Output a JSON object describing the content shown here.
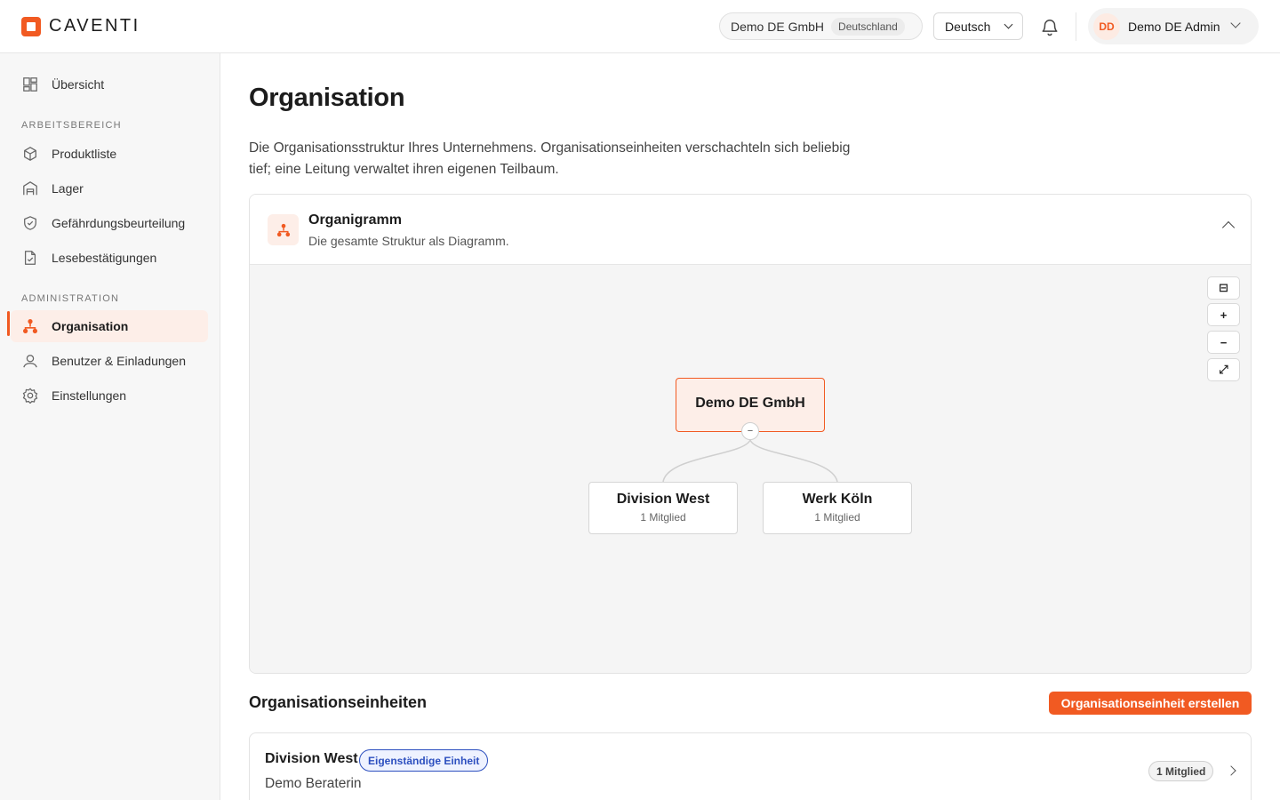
{
  "brand": {
    "name": "CAVENTI"
  },
  "topbar": {
    "org_name": "Demo DE GmbH",
    "org_country": "Deutschland",
    "language": "Deutsch",
    "user_initials": "DD",
    "user_name": "Demo DE Admin"
  },
  "sidebar": {
    "overview": "Übersicht",
    "section_workspace": "ARBEITSBEREICH",
    "workspace_items": [
      "Produktliste",
      "Lager",
      "Gefährdungsbeurteilung",
      "Lesebestätigungen"
    ],
    "section_admin": "ADMINISTRATION",
    "admin_items": [
      "Organisation",
      "Benutzer & Einladungen",
      "Einstellungen"
    ],
    "active_item": "Organisation"
  },
  "main": {
    "title": "Organisation",
    "description": "Die Organisationsstruktur Ihres Unternehmens. Organisationseinheiten verschachteln sich beliebig tief; eine Leitung verwaltet ihren eigenen Teilbaum.",
    "orgchart": {
      "title": "Organigramm",
      "subtitle": "Die gesamte Struktur als Diagramm.",
      "controls": {
        "fit": "⊟",
        "zoom_in": "+",
        "zoom_out": "−",
        "fullscreen": "⤢"
      },
      "root": {
        "name": "Demo DE GmbH",
        "collapse": "−"
      },
      "children": [
        {
          "name": "Division West",
          "members": "1 Mitglied"
        },
        {
          "name": "Werk Köln",
          "members": "1 Mitglied"
        }
      ]
    },
    "units_section": {
      "title": "Organisationseinheiten",
      "create_button": "Organisationseinheit erstellen",
      "units": [
        {
          "name": "Division West",
          "badge": "Eigenständige Einheit",
          "lead": "Demo Beraterin",
          "members": "1 Mitglied"
        }
      ]
    }
  },
  "colors": {
    "accent": "#f15a22",
    "badge_blue": "#2c4fbf"
  }
}
